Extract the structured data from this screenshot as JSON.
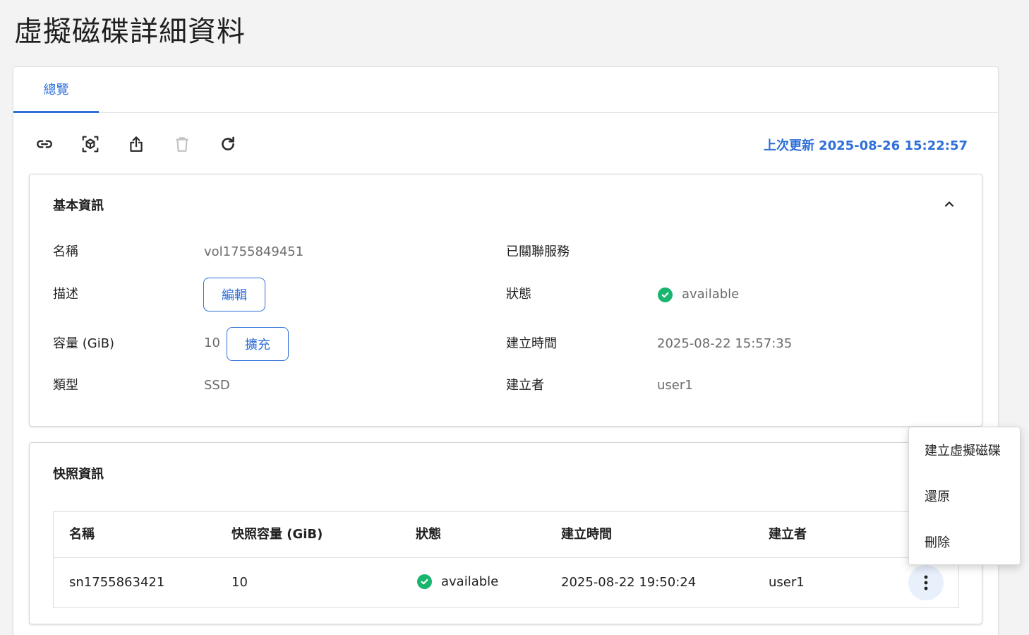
{
  "page": {
    "title": "虛擬磁碟詳細資料"
  },
  "tabs": [
    {
      "label": "總覽"
    }
  ],
  "toolbar": {
    "last_update_label": "上次更新",
    "last_update_value": "2025-08-26 15:22:57"
  },
  "basic_info": {
    "title": "基本資訊",
    "name_label": "名稱",
    "name_value": "vol1755849451",
    "description_label": "描述",
    "edit_button": "編輯",
    "capacity_label": "容量 (GiB)",
    "capacity_value": "10",
    "expand_button": "擴充",
    "type_label": "類型",
    "type_value": "SSD",
    "linked_service_label": "已關聯服務",
    "status_label": "狀態",
    "status_value": "available",
    "created_time_label": "建立時間",
    "created_time_value": "2025-08-22 15:57:35",
    "creator_label": "建立者",
    "creator_value": "user1"
  },
  "snapshot_info": {
    "title": "快照資訊",
    "columns": [
      "名稱",
      "快照容量 (GiB)",
      "狀態",
      "建立時間",
      "建立者"
    ],
    "rows": [
      {
        "name": "sn1755863421",
        "size": "10",
        "status": "available",
        "created_time": "2025-08-22 19:50:24",
        "creator": "user1"
      }
    ]
  },
  "context_menu": {
    "items": [
      "建立虛擬磁碟",
      "還原",
      "刪除"
    ]
  },
  "colors": {
    "accent": "#2e6fd8",
    "success": "#19b56f",
    "background": "#f3f3f4"
  },
  "icons": [
    "link-icon",
    "volume-cube-icon",
    "share-icon",
    "trash-icon",
    "refresh-icon",
    "chevron-up-icon",
    "check-circle-icon",
    "kebab-menu-icon"
  ]
}
